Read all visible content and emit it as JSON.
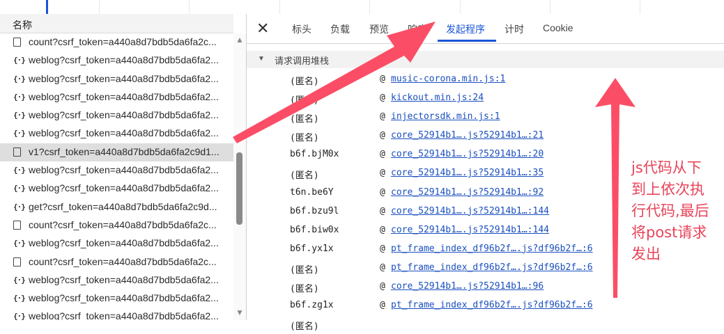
{
  "left_panel": {
    "column_header": "名称",
    "requests": [
      {
        "icon": "doc",
        "name": "count?csrf_token=a440a8d7bdb5da6fa2c..."
      },
      {
        "icon": "js",
        "name": "weblog?csrf_token=a440a8d7bdb5da6fa2..."
      },
      {
        "icon": "js",
        "name": "weblog?csrf_token=a440a8d7bdb5da6fa2..."
      },
      {
        "icon": "js",
        "name": "weblog?csrf_token=a440a8d7bdb5da6fa2..."
      },
      {
        "icon": "js",
        "name": "weblog?csrf_token=a440a8d7bdb5da6fa2..."
      },
      {
        "icon": "js",
        "name": "weblog?csrf_token=a440a8d7bdb5da6fa2..."
      },
      {
        "icon": "doc",
        "name": "v1?csrf_token=a440a8d7bdb5da6fa2c9d1...",
        "selected": true
      },
      {
        "icon": "js",
        "name": "weblog?csrf_token=a440a8d7bdb5da6fa2..."
      },
      {
        "icon": "js",
        "name": "weblog?csrf_token=a440a8d7bdb5da6fa2..."
      },
      {
        "icon": "js",
        "name": "get?csrf_token=a440a8d7bdb5da6fa2c9d..."
      },
      {
        "icon": "doc",
        "name": "count?csrf_token=a440a8d7bdb5da6fa2c..."
      },
      {
        "icon": "js",
        "name": "weblog?csrf_token=a440a8d7bdb5da6fa2..."
      },
      {
        "icon": "doc",
        "name": "count?csrf_token=a440a8d7bdb5da6fa2c..."
      },
      {
        "icon": "js",
        "name": "weblog?csrf_token=a440a8d7bdb5da6fa2..."
      },
      {
        "icon": "js",
        "name": "weblog?csrf_token=a440a8d7bdb5da6fa2..."
      },
      {
        "icon": "js",
        "name": "weblog?csrf_token=a440a8d7bdb5da6fa2..."
      }
    ]
  },
  "tabs": {
    "close_symbol": "✕",
    "items": [
      "标头",
      "负载",
      "预览",
      "响应",
      "发起程序",
      "计时",
      "Cookie"
    ],
    "active": "发起程序"
  },
  "initiator": {
    "section_title": "请求调用堆栈",
    "frames": [
      {
        "fn": "(匿名)",
        "at": "@",
        "loc": "music-corona.min.js:1"
      },
      {
        "fn": "(匿名)",
        "at": "@",
        "loc": "kickout.min.js:24"
      },
      {
        "fn": "(匿名)",
        "at": "@",
        "loc": "injectorsdk.min.js:1"
      },
      {
        "fn": "(匿名)",
        "at": "@",
        "loc": "core_52914b1….js?52914b1…:21"
      },
      {
        "fn": "b6f.bjM0x",
        "at": "@",
        "loc": "core_52914b1….js?52914b1…:20"
      },
      {
        "fn": "(匿名)",
        "at": "@",
        "loc": "core_52914b1….js?52914b1…:35"
      },
      {
        "fn": "t6n.be6Y",
        "at": "@",
        "loc": "core_52914b1….js?52914b1…:92"
      },
      {
        "fn": "b6f.bzu9l",
        "at": "@",
        "loc": "core_52914b1….js?52914b1…:144"
      },
      {
        "fn": "b6f.biw0x",
        "at": "@",
        "loc": "core_52914b1….js?52914b1…:144"
      },
      {
        "fn": "b6f.yx1x",
        "at": "@",
        "loc": "pt_frame_index_df96b2f….js?df96b2f…:6"
      },
      {
        "fn": "(匿名)",
        "at": "@",
        "loc": "pt_frame_index_df96b2f….js?df96b2f…:6"
      },
      {
        "fn": "(匿名)",
        "at": "@",
        "loc": "core_52914b1….js?52914b1…:96"
      },
      {
        "fn": "b6f.zg1x",
        "at": "@",
        "loc": "pt_frame_index_df96b2f….js?df96b2f…:6"
      },
      {
        "fn": "(匿名)",
        "at": "",
        "loc": ""
      }
    ]
  },
  "annotation": {
    "color": "#e8445a",
    "lines": [
      "js代码从下",
      "到上依次执",
      "行代码,最后",
      "将post请求",
      "发出"
    ]
  }
}
